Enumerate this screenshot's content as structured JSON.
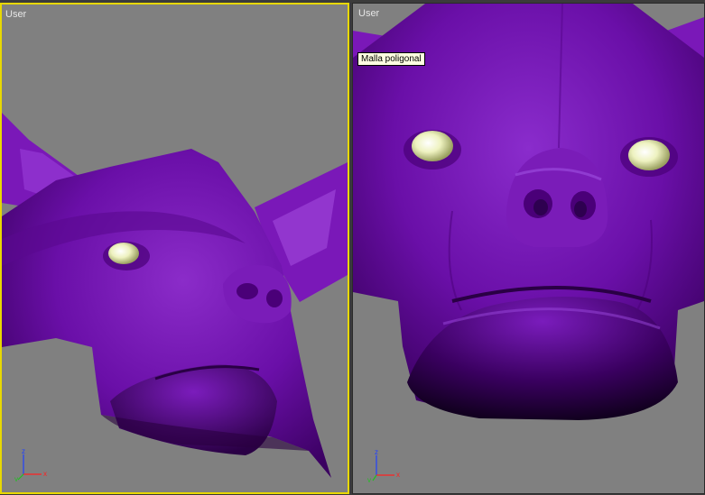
{
  "viewports": {
    "left": {
      "label": "User",
      "active": true
    },
    "right": {
      "label": "User",
      "active": false
    }
  },
  "tooltip": {
    "text": "Malla poligonal"
  },
  "axis": {
    "x": "x",
    "y": "y",
    "z": "z"
  },
  "colors": {
    "viewport_bg": "#808080",
    "active_border": "#e8d800",
    "mesh_purple": "#6a0fa8",
    "eye": "#f2f5c8"
  }
}
